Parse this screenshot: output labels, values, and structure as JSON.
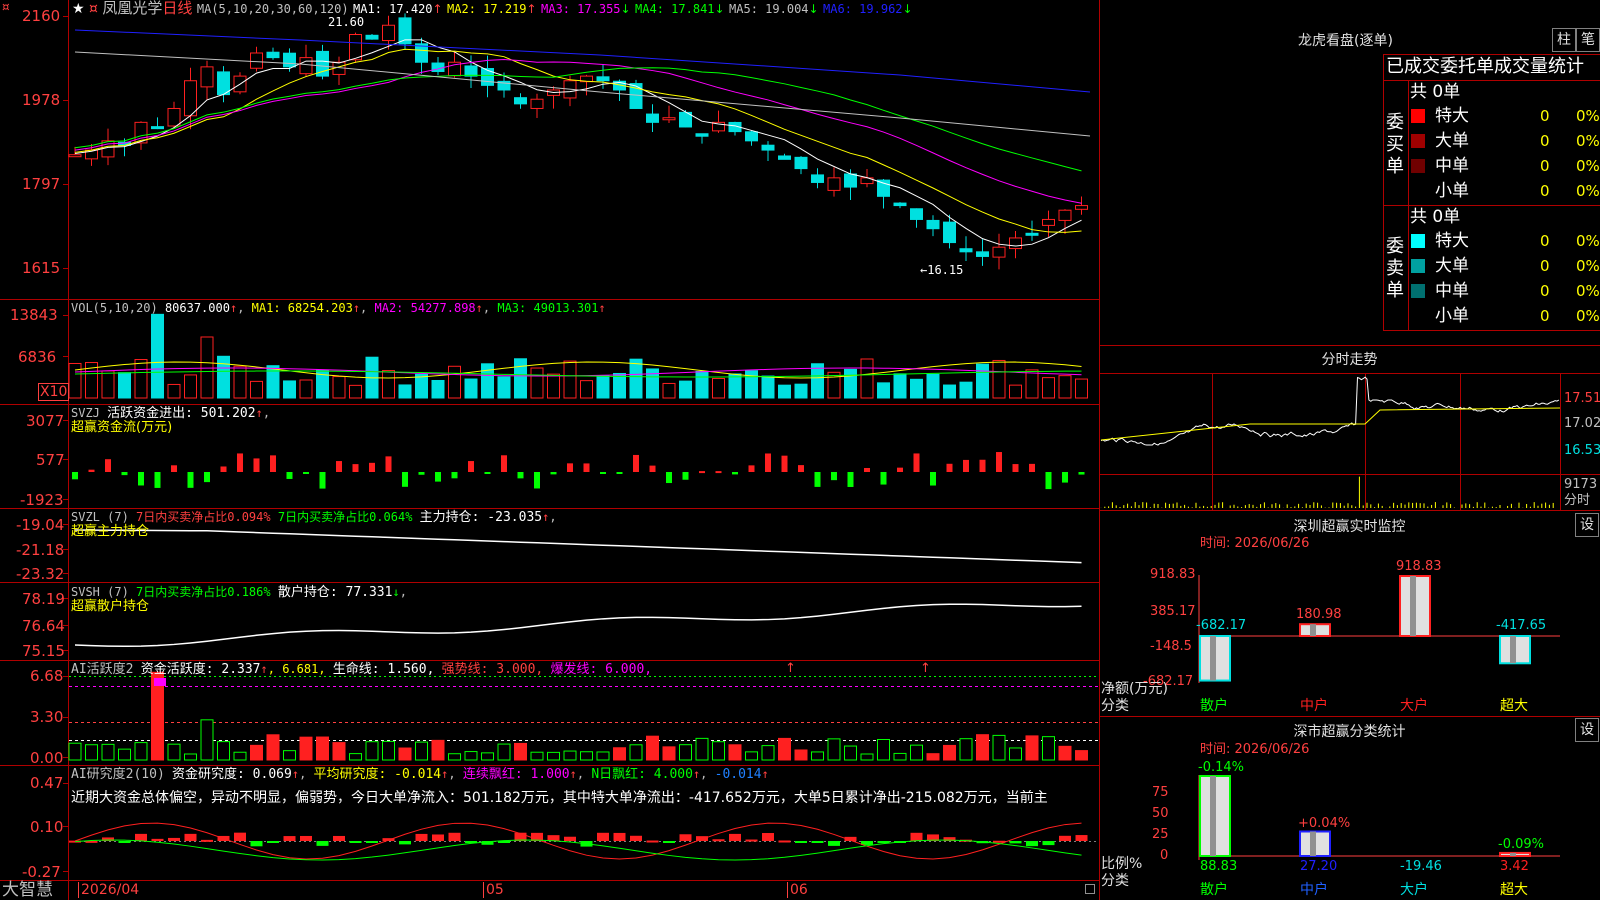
{
  "app": {
    "logo": "大智慧",
    "stock_name": "凤凰光学",
    "period": "日线"
  },
  "colors": {
    "up": "#ff2020",
    "down": "#00e0e0",
    "ma1": "#ffffff",
    "ma2": "#ffff00",
    "ma3": "#ff00ff",
    "ma4": "#00ff00",
    "ma5": "#c0c0c0",
    "ma6": "#0000ff",
    "grid": "#b00000",
    "label": "#c0c0c0",
    "green": "#00ff00"
  },
  "main": {
    "ma_header": "MA(5,10,20,30,60,120)",
    "ma": [
      {
        "label": "MA1: 17.420",
        "arrow": "↑"
      },
      {
        "label": "MA2: 17.219",
        "arrow": "↑"
      },
      {
        "label": "MA3: 17.355",
        "arrow": "↓"
      },
      {
        "label": "MA4: 17.841",
        "arrow": "↓"
      },
      {
        "label": "MA5: 19.004",
        "arrow": "↓"
      },
      {
        "label": "MA6: 19.962",
        "arrow": "↓"
      }
    ],
    "y_labels": [
      "2160",
      "1978",
      "1797",
      "1615"
    ],
    "high_label": "21.60",
    "low_label": "←16.15",
    "star": "★",
    "corner_icon": "¤"
  },
  "vol": {
    "header": "VOL(5,10,20)",
    "value": "80637.000",
    "ma": [
      {
        "label": "MA1: 68254.203",
        "arrow": "↑"
      },
      {
        "label": "MA2: 54277.898",
        "arrow": "↑"
      },
      {
        "label": "MA3: 49013.301",
        "arrow": "↑"
      }
    ],
    "y_labels": [
      "13843",
      "6836"
    ],
    "unit": "X10"
  },
  "svzj": {
    "header": "SVZJ",
    "line1": "活跃资金进出: 501.202",
    "arrow": "↑",
    "comma": ",",
    "line2": "超赢资金流(万元)",
    "y_labels": [
      "3077",
      "577",
      "-1923"
    ]
  },
  "svzl": {
    "header": "SVZL (7)",
    "a": "7日内买卖净占比0.094%",
    "b": "7日内买卖净占比0.064%",
    "c": "主力持仓: -23.035",
    "arrow": "↑",
    "comma": ",",
    "line2": "超赢主力持仓",
    "y_labels": [
      "-19.04",
      "-21.18",
      "-23.32"
    ]
  },
  "svsh": {
    "header": "SVSH (7)",
    "a": "7日内买卖净占比0.186%",
    "b": "散户持仓: 77.331",
    "arrow": "↓",
    "comma": ",",
    "line2": "超赢散户持仓",
    "y_labels": [
      "78.19",
      "76.64",
      "75.15"
    ]
  },
  "ai1": {
    "header": "AI活跃度2",
    "a": "资金活跃度: 2.337",
    "a_arrow": "↑",
    "b": ", 6.681,",
    "c": "生命线: 1.560,",
    "d": "强势线: 3.000,",
    "e": "爆发线: 6.000,",
    "y_labels": [
      "6.68",
      "3.30",
      "0.00"
    ],
    "arrow_mark": "↑"
  },
  "ai2": {
    "header": "AI研究度2(10)",
    "a": "资金研究度: 0.069",
    "a_arrow": "↑",
    "b": "平均研究度: -0.014",
    "b_arrow": "↑",
    "c": "连续飘红: 1.000",
    "c_arrow": "↑",
    "d": "N日飘红: 4.000",
    "d_arrow": "↑",
    "e": "-0.014",
    "e_arrow": "↑",
    "comment": "近期大资金总体偏空，异动不明显，偏弱势，今日大单净流入：501.182万元，其中特大单净流出：-417.652万元，大单5日累计净出-215.082万元，当前主",
    "y_labels": [
      "0.47",
      "0.10",
      "-0.27"
    ]
  },
  "x_axis": [
    "2026/04",
    "05",
    "06"
  ],
  "right": {
    "lhb_title": "龙虎看盘(逐单)",
    "btn_zhu": "柱",
    "btn_bi": "笔",
    "stats_title": "已成交委托单成交量统计",
    "buy_label": "委买单",
    "sell_label": "委卖单",
    "buy_total": "共 0单",
    "sell_total": "共 0单",
    "rows_buy": [
      {
        "name": "特大",
        "v": "0",
        "p": "0%",
        "c": "#ff0000"
      },
      {
        "name": "大单",
        "v": "0",
        "p": "0%",
        "c": "#a00000"
      },
      {
        "name": "中单",
        "v": "0",
        "p": "0%",
        "c": "#700000"
      },
      {
        "name": "小单",
        "v": "0",
        "p": "0%",
        "c": "#000000"
      }
    ],
    "rows_sell": [
      {
        "name": "特大",
        "v": "0",
        "p": "0%",
        "c": "#00ffff"
      },
      {
        "name": "大单",
        "v": "0",
        "p": "0%",
        "c": "#00a0a0"
      },
      {
        "name": "中单",
        "v": "0",
        "p": "0%",
        "c": "#007070"
      },
      {
        "name": "小单",
        "v": "0",
        "p": "0%",
        "c": "#000000"
      }
    ],
    "fs_title": "分时走势",
    "fs_labels": [
      "17.51",
      "17.02",
      "16.53"
    ],
    "fs_vol": "9173",
    "fs_vol_unit": "分时",
    "mon_title": "深圳超赢实时监控",
    "mon_btn": "设",
    "mon_date": "时间: 2026/06/26",
    "mon_y": [
      "918.83",
      "385.17",
      "-148.5",
      "-682.17"
    ],
    "mon_bars": [
      {
        "cat": "散户",
        "v": "-682.17",
        "val": -682.17
      },
      {
        "cat": "中户",
        "v": "180.98",
        "val": 180.98
      },
      {
        "cat": "大户",
        "v": "918.83",
        "val": 918.83
      },
      {
        "cat": "超大",
        "v": "-417.65",
        "val": -417.65
      }
    ],
    "mon_axis_lbl1": "净额(万元)",
    "mon_axis_lbl2": "分类",
    "cls_title": "深市超赢分类统计",
    "cls_btn": "设",
    "cls_date": "时间: 2026/06/26",
    "cls_y": [
      "75",
      "50",
      "25",
      "0"
    ],
    "cls_bars": [
      {
        "cat": "散户",
        "pct": "-0.14%",
        "v": "88.83",
        "val": 88.83
      },
      {
        "cat": "中户",
        "pct": "+0.04%",
        "v": "27.20",
        "val": 27.2
      },
      {
        "cat": "大户",
        "pct": "",
        "v": "-19.46",
        "val": 0
      },
      {
        "cat": "超大",
        "pct": "-0.09%",
        "v": "3.42",
        "val": 3.42
      }
    ],
    "cls_axis_lbl1": "比例%",
    "cls_axis_lbl2": "分类"
  }
}
